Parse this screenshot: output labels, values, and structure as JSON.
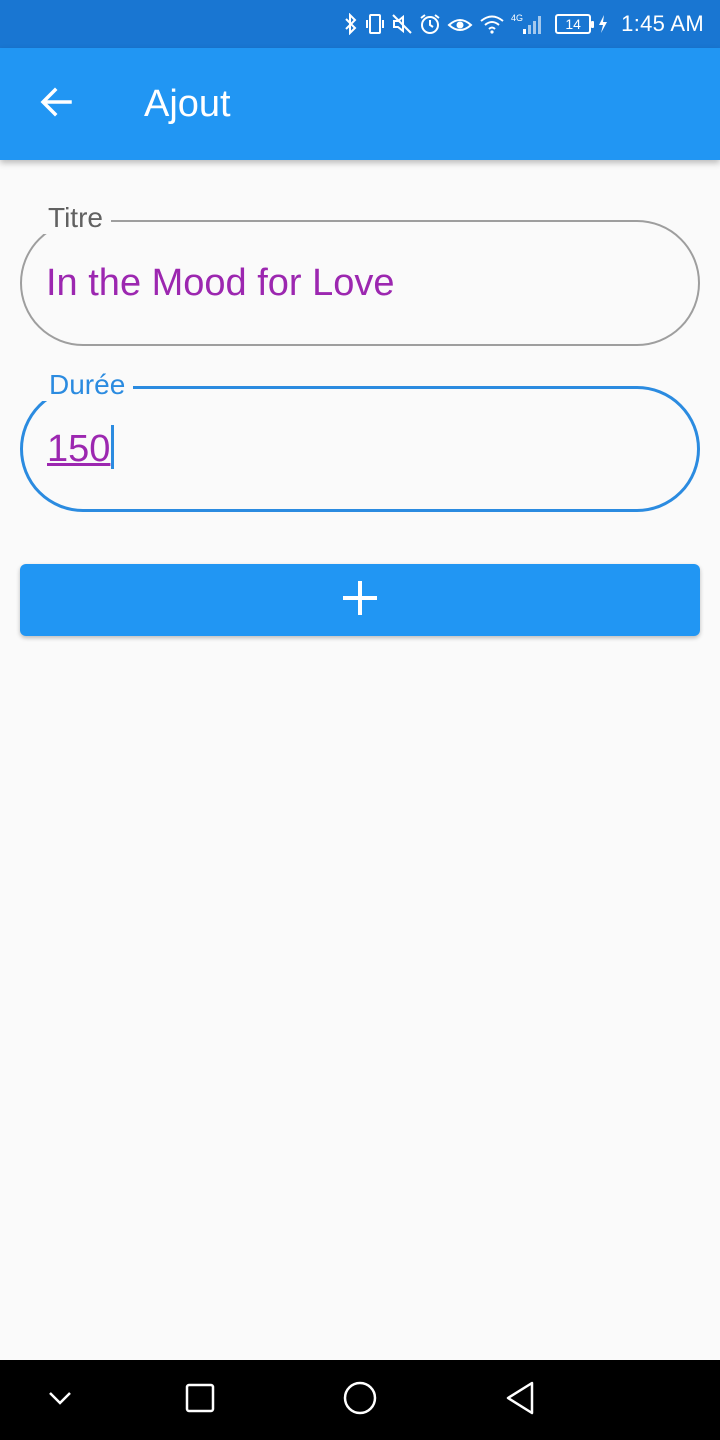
{
  "status_bar": {
    "battery_level": "14",
    "time": "1:45 AM",
    "network_label": "4G",
    "icons": [
      "bluetooth-icon",
      "vibrate-icon",
      "mute-icon",
      "alarm-icon",
      "eye-comfort-icon",
      "wifi-icon",
      "signal-icon",
      "battery-icon",
      "charging-icon"
    ]
  },
  "app_bar": {
    "title": "Ajout",
    "back_icon": "arrow-back-icon",
    "background": "#2196f3"
  },
  "form": {
    "titre": {
      "label": "Titre",
      "value": "In the Mood for Love"
    },
    "duree": {
      "label": "Durée",
      "value": "150"
    }
  },
  "add_button": {
    "icon": "plus-icon"
  },
  "nav_bar": {
    "icons": [
      "chevron-down-icon",
      "recent-apps-icon",
      "home-icon",
      "back-icon"
    ]
  },
  "colors": {
    "primary": "#2196f3",
    "status_bar": "#1976d2",
    "input_text": "#9c27b0",
    "focus_border": "#2b8be0"
  }
}
